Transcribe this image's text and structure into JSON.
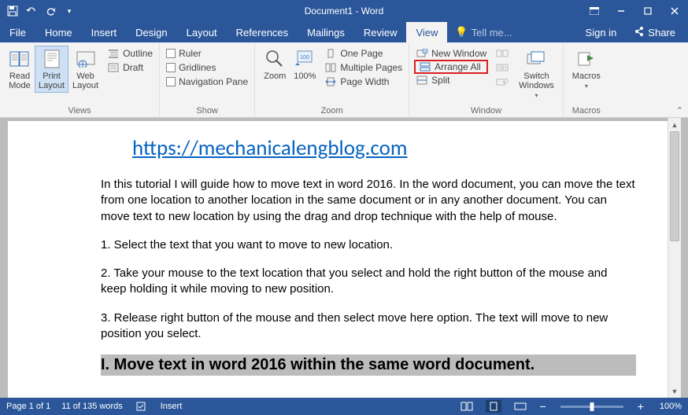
{
  "titlebar": {
    "title": "Document1 - Word"
  },
  "tabs": {
    "file": "File",
    "items": [
      "Home",
      "Insert",
      "Design",
      "Layout",
      "References",
      "Mailings",
      "Review",
      "View"
    ],
    "active_index": 7,
    "tellme": "Tell me...",
    "signin": "Sign in",
    "share": "Share"
  },
  "ribbon": {
    "views": {
      "label": "Views",
      "read_mode": "Read\nMode",
      "print_layout": "Print\nLayout",
      "web_layout": "Web\nLayout",
      "outline": "Outline",
      "draft": "Draft"
    },
    "show": {
      "label": "Show",
      "ruler": "Ruler",
      "gridlines": "Gridlines",
      "nav_pane": "Navigation Pane"
    },
    "zoom": {
      "label": "Zoom",
      "zoom": "Zoom",
      "pct": "100%",
      "one_page": "One Page",
      "multi_pages": "Multiple Pages",
      "page_width": "Page Width"
    },
    "window": {
      "label": "Window",
      "new_window": "New Window",
      "arrange_all": "Arrange All",
      "split": "Split",
      "switch": "Switch\nWindows"
    },
    "macros": {
      "label": "Macros",
      "macros": "Macros"
    }
  },
  "document": {
    "url": "https://mechanicalengblog.com",
    "p1": "In this tutorial I will guide how to move text in word 2016. In the word document, you can move the text from one location to another location in the same document or in any another document. You can move text to new location by using the drag and drop technique with the help of mouse.",
    "p2": "1. Select the text that you want to move to new location.",
    "p3": "2. Take your mouse to the text location that you select and hold the right button of the mouse and keep holding it while moving to new position.",
    "p4": "3. Release right button of the mouse and then select move here option. The text will move to new position you select.",
    "h1": "I. Move text in word 2016 within the same word document."
  },
  "statusbar": {
    "page": "Page 1 of 1",
    "words": "11 of 135 words",
    "mode": "Insert",
    "zoom_minus": "−",
    "zoom_plus": "+",
    "zoom_pct": "100%"
  }
}
